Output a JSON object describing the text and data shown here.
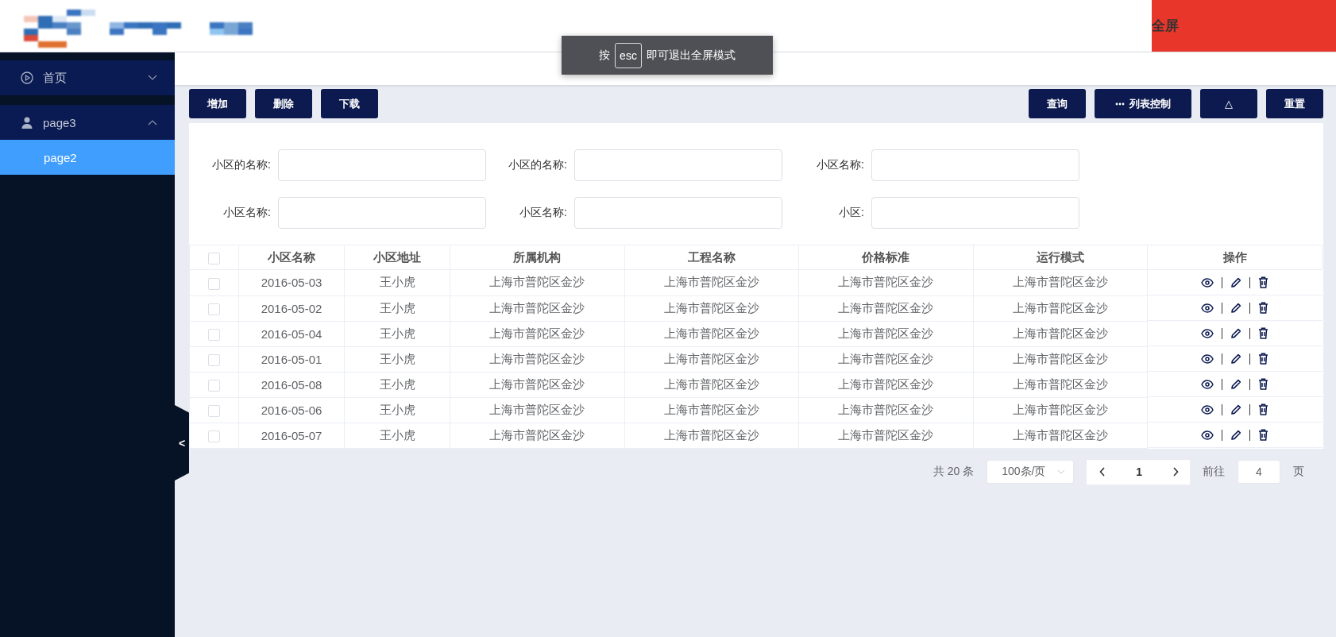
{
  "header": {
    "fullscreen_button": "全屏"
  },
  "toast": {
    "before": "按",
    "key": "esc",
    "after": "即可退出全屏模式"
  },
  "sidebar": {
    "items": [
      {
        "label": "首页",
        "expanded": false
      },
      {
        "label": "page3",
        "expanded": true,
        "children": [
          {
            "label": "page2",
            "selected": true
          }
        ]
      }
    ],
    "collapse_handle": "<"
  },
  "toolbar": {
    "left": [
      "增加",
      "删除",
      "下载"
    ],
    "right": [
      {
        "label": "查询",
        "kind": "text"
      },
      {
        "label": "列表控制",
        "kind": "more"
      },
      {
        "label": "△",
        "kind": "text"
      },
      {
        "label": "重置",
        "kind": "text"
      }
    ]
  },
  "filters": [
    [
      {
        "label": "小区的名称:"
      },
      {
        "label": "小区的名称:"
      },
      {
        "label": "小区名称:"
      }
    ],
    [
      {
        "label": "小区名称:"
      },
      {
        "label": "小区名称:"
      },
      {
        "label": "小区:"
      }
    ]
  ],
  "table": {
    "all_checked": false,
    "columns": [
      "小区名称",
      "小区地址",
      "所属机构",
      "工程名称",
      "价格标准",
      "运行模式",
      "操作"
    ],
    "rows": [
      {
        "checked": false,
        "cells": [
          "2016-05-03",
          "王小虎",
          "上海市普陀区金沙",
          "上海市普陀区金沙",
          "上海市普陀区金沙",
          "上海市普陀区金沙"
        ]
      },
      {
        "checked": false,
        "cells": [
          "2016-05-02",
          "王小虎",
          "上海市普陀区金沙",
          "上海市普陀区金沙",
          "上海市普陀区金沙",
          "上海市普陀区金沙"
        ]
      },
      {
        "checked": false,
        "cells": [
          "2016-05-04",
          "王小虎",
          "上海市普陀区金沙",
          "上海市普陀区金沙",
          "上海市普陀区金沙",
          "上海市普陀区金沙"
        ]
      },
      {
        "checked": false,
        "cells": [
          "2016-05-01",
          "王小虎",
          "上海市普陀区金沙",
          "上海市普陀区金沙",
          "上海市普陀区金沙",
          "上海市普陀区金沙"
        ]
      },
      {
        "checked": false,
        "cells": [
          "2016-05-08",
          "王小虎",
          "上海市普陀区金沙",
          "上海市普陀区金沙",
          "上海市普陀区金沙",
          "上海市普陀区金沙"
        ]
      },
      {
        "checked": false,
        "cells": [
          "2016-05-06",
          "王小虎",
          "上海市普陀区金沙",
          "上海市普陀区金沙",
          "上海市普陀区金沙",
          "上海市普陀区金沙"
        ]
      },
      {
        "checked": false,
        "cells": [
          "2016-05-07",
          "王小虎",
          "上海市普陀区金沙",
          "上海市普陀区金沙",
          "上海市普陀区金沙",
          "上海市普陀区金沙"
        ]
      }
    ]
  },
  "pagination": {
    "total": "共 20 条",
    "page_size": "100条/页",
    "current_page": "1",
    "goto_label": "前往",
    "goto_value": "4",
    "goto_suffix": "页"
  }
}
